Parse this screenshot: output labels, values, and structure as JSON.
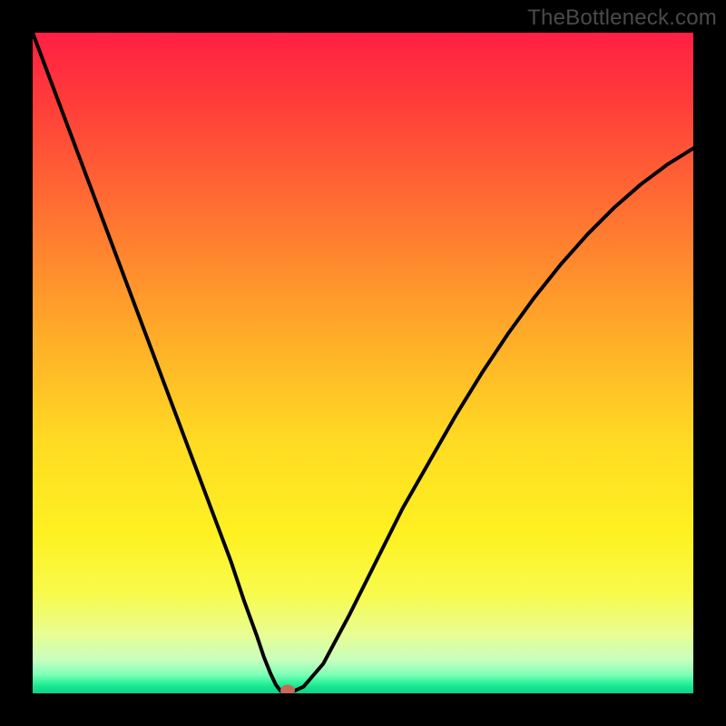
{
  "attribution": "TheBottleneck.com",
  "chart_data": {
    "type": "line",
    "title": "",
    "xlabel": "",
    "ylabel": "",
    "xlim": [
      0,
      100
    ],
    "ylim": [
      0,
      100
    ],
    "series": [
      {
        "name": "bottleneck-curve",
        "x": [
          0,
          3,
          6,
          9,
          12,
          15,
          18,
          21,
          24,
          27,
          30,
          32,
          34,
          35,
          36,
          36.8,
          37.5,
          38.3,
          39,
          41,
          44,
          48,
          52,
          56,
          60,
          64,
          68,
          72,
          76,
          80,
          84,
          88,
          92,
          96,
          100
        ],
        "values": [
          100,
          92,
          84,
          76,
          68,
          60,
          52,
          44,
          36,
          28,
          20,
          14,
          8.5,
          5.5,
          3.0,
          1.3,
          0.4,
          0.1,
          0.1,
          1.0,
          4.5,
          12,
          20,
          28,
          35,
          42,
          48.5,
          54.5,
          60,
          65,
          69.5,
          73.5,
          77,
          80,
          82.5
        ]
      }
    ],
    "marker": {
      "x": 38.6,
      "y": 0.45,
      "rx": 1.1,
      "ry": 0.85,
      "color": "#c66a5a"
    },
    "gradient_stops": [
      {
        "pos": 0.0,
        "color": "#ff1f44"
      },
      {
        "pos": 0.1,
        "color": "#ff3b3a"
      },
      {
        "pos": 0.25,
        "color": "#ff6a33"
      },
      {
        "pos": 0.38,
        "color": "#ff942c"
      },
      {
        "pos": 0.5,
        "color": "#ffb827"
      },
      {
        "pos": 0.62,
        "color": "#ffdb23"
      },
      {
        "pos": 0.76,
        "color": "#fef121"
      },
      {
        "pos": 0.85,
        "color": "#f8fb4d"
      },
      {
        "pos": 0.91,
        "color": "#e9fd92"
      },
      {
        "pos": 0.95,
        "color": "#c7ffbf"
      },
      {
        "pos": 0.972,
        "color": "#7dffb6"
      },
      {
        "pos": 0.983,
        "color": "#34f39d"
      },
      {
        "pos": 0.991,
        "color": "#15e28e"
      },
      {
        "pos": 1.0,
        "color": "#0fd487"
      }
    ]
  }
}
